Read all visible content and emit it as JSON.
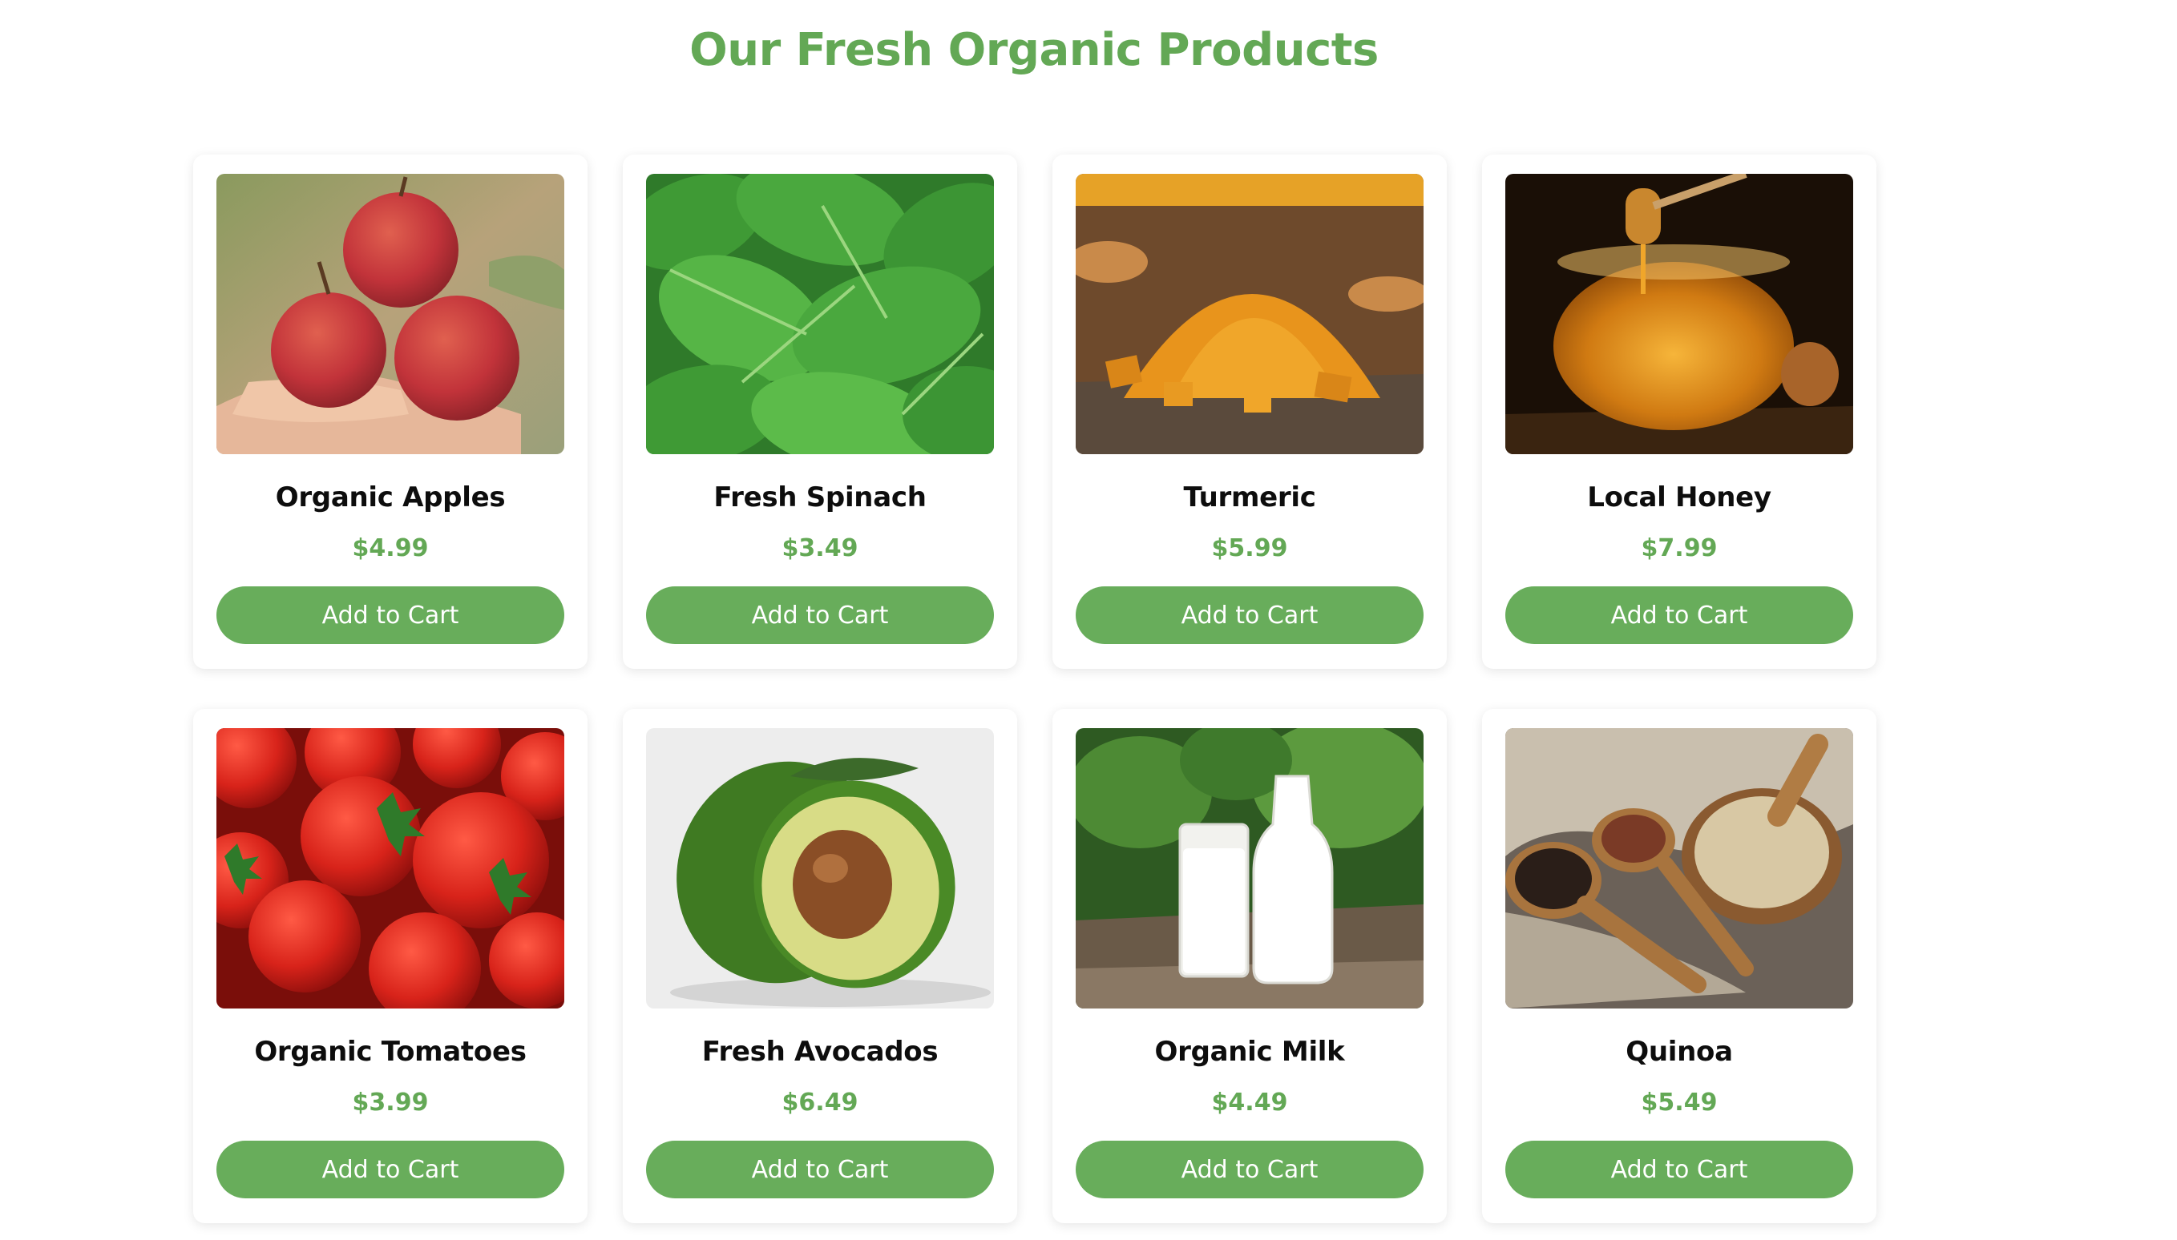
{
  "page": {
    "title": "Our Fresh Organic Products"
  },
  "products": [
    {
      "name": "Organic Apples",
      "price": "$4.99",
      "button": "Add to Cart",
      "image": "apples-photo"
    },
    {
      "name": "Fresh Spinach",
      "price": "$3.49",
      "button": "Add to Cart",
      "image": "spinach-photo"
    },
    {
      "name": "Turmeric",
      "price": "$5.99",
      "button": "Add to Cart",
      "image": "turmeric-photo"
    },
    {
      "name": "Local Honey",
      "price": "$7.99",
      "button": "Add to Cart",
      "image": "honey-photo"
    },
    {
      "name": "Organic Tomatoes",
      "price": "$3.99",
      "button": "Add to Cart",
      "image": "tomatoes-photo"
    },
    {
      "name": "Fresh Avocados",
      "price": "$6.49",
      "button": "Add to Cart",
      "image": "avocado-photo"
    },
    {
      "name": "Organic Milk",
      "price": "$4.49",
      "button": "Add to Cart",
      "image": "milk-photo"
    },
    {
      "name": "Quinoa",
      "price": "$5.49",
      "button": "Add to Cart",
      "image": "quinoa-photo"
    }
  ],
  "colors": {
    "accent": "#63a855",
    "button": "#68ad5b",
    "text": "#0d0d0d"
  }
}
